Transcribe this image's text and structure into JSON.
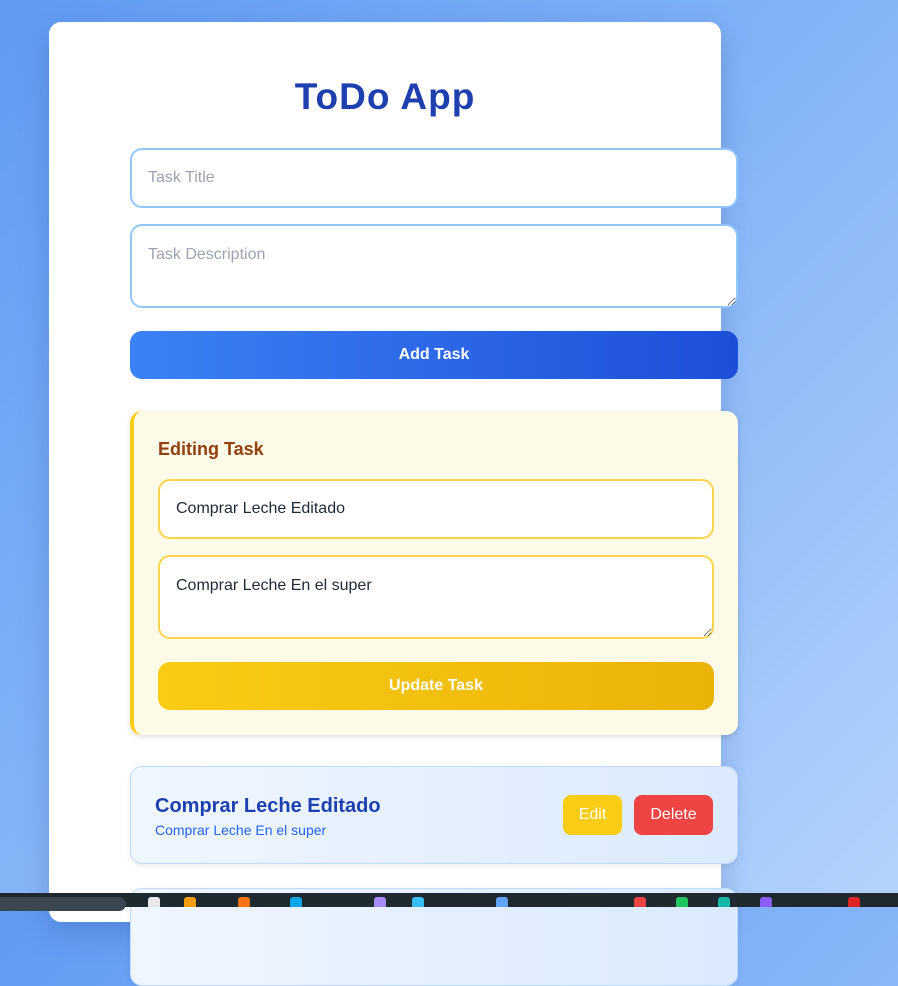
{
  "app": {
    "title": "ToDo App"
  },
  "new_task": {
    "title_placeholder": "Task Title",
    "description_placeholder": "Task Description",
    "add_label": "Add Task"
  },
  "editing": {
    "heading": "Editing Task",
    "title_value": "Comprar Leche Editado",
    "description_value": "Comprar Leche En el super",
    "update_label": "Update Task"
  },
  "tasks": [
    {
      "title": "Comprar Leche Editado",
      "description": "Comprar Leche En el super",
      "edit_label": "Edit",
      "delete_label": "Delete"
    }
  ],
  "colors": {
    "primary": "#1e40af",
    "accent_blue": "#3b82f6",
    "accent_yellow": "#facc15",
    "danger": "#ef4444"
  }
}
